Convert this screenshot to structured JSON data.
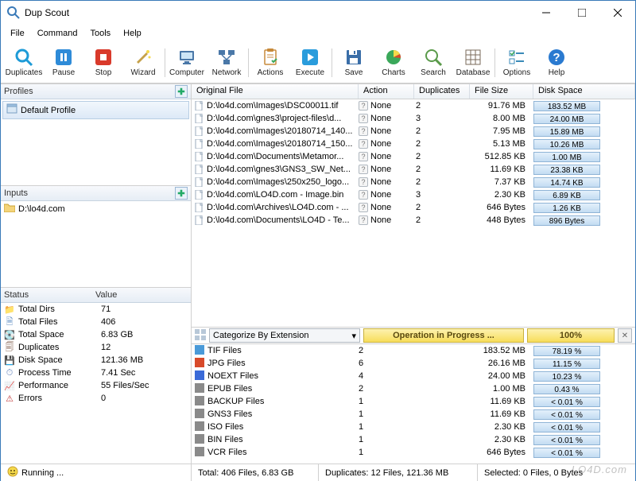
{
  "app": {
    "title": "Dup Scout"
  },
  "menu": [
    "File",
    "Command",
    "Tools",
    "Help"
  ],
  "toolbar": [
    {
      "id": "duplicates",
      "label": "Duplicates",
      "icon": "#1e9bd7",
      "glyph": "⟳",
      "shape": "magnify"
    },
    {
      "id": "pause",
      "label": "Pause",
      "icon": "#2e8bd8",
      "glyph": "⏸",
      "shape": "pause"
    },
    {
      "id": "stop",
      "label": "Stop",
      "icon": "#d93a2b",
      "glyph": "⏹",
      "shape": "stop"
    },
    {
      "id": "wizard",
      "label": "Wizard",
      "icon": "#c6a14a",
      "glyph": "🪄",
      "shape": "wizard"
    },
    {
      "id": "sep"
    },
    {
      "id": "computer",
      "label": "Computer",
      "icon": "#4a78a8",
      "glyph": "🖥",
      "shape": "monitor"
    },
    {
      "id": "network",
      "label": "Network",
      "icon": "#4a78a8",
      "glyph": "🖧",
      "shape": "network"
    },
    {
      "id": "sep"
    },
    {
      "id": "actions",
      "label": "Actions",
      "icon": "#c78a3a",
      "glyph": "📋",
      "shape": "clipboard"
    },
    {
      "id": "execute",
      "label": "Execute",
      "icon": "#2a9cdc",
      "glyph": "▶",
      "shape": "play"
    },
    {
      "id": "sep"
    },
    {
      "id": "save",
      "label": "Save",
      "icon": "#3a6ea8",
      "glyph": "💾",
      "shape": "floppy"
    },
    {
      "id": "charts",
      "label": "Charts",
      "icon": "#3aa85a",
      "glyph": "📊",
      "shape": "pie"
    },
    {
      "id": "search",
      "label": "Search",
      "icon": "#5a9a4a",
      "glyph": "🔍",
      "shape": "magnify2"
    },
    {
      "id": "database",
      "label": "Database",
      "icon": "#7a6a5a",
      "glyph": "🗄",
      "shape": "grid"
    },
    {
      "id": "sep"
    },
    {
      "id": "options",
      "label": "Options",
      "icon": "#3a8ab8",
      "glyph": "☑",
      "shape": "checklist"
    },
    {
      "id": "help",
      "label": "Help",
      "icon": "#2a7ad0",
      "glyph": "?",
      "shape": "help"
    }
  ],
  "profiles": {
    "title": "Profiles",
    "items": [
      "Default Profile"
    ]
  },
  "inputs": {
    "title": "Inputs",
    "items": [
      "D:\\lo4d.com"
    ]
  },
  "status_cols": {
    "k": "Status",
    "v": "Value"
  },
  "status_rows": [
    {
      "k": "Total Dirs",
      "v": "71",
      "glyph": "📁",
      "color": "#e6b84a"
    },
    {
      "k": "Total Files",
      "v": "406",
      "glyph": "🗎",
      "color": "#5a8ac0"
    },
    {
      "k": "Total Space",
      "v": "6.83 GB",
      "glyph": "💽",
      "color": "#6a9a7a"
    },
    {
      "k": "Duplicates",
      "v": "12",
      "glyph": "🗐",
      "color": "#8a6a5a"
    },
    {
      "k": "Disk Space",
      "v": "121.36 MB",
      "glyph": "💾",
      "color": "#3a6ea8"
    },
    {
      "k": "Process Time",
      "v": "7.41 Sec",
      "glyph": "⏱",
      "color": "#6a8ac0"
    },
    {
      "k": "Performance",
      "v": "55 Files/Sec",
      "glyph": "📈",
      "color": "#c06a3a"
    },
    {
      "k": "Errors",
      "v": "0",
      "glyph": "⚠",
      "color": "#c03a3a"
    }
  ],
  "main_cols": {
    "file": "Original File",
    "action": "Action",
    "dup": "Duplicates",
    "size": "File Size",
    "space": "Disk Space"
  },
  "rows": [
    {
      "file": "D:\\lo4d.com\\Images\\DSC00011.tif",
      "action": "None",
      "dup": "2",
      "size": "91.76 MB",
      "space": "183.52 MB"
    },
    {
      "file": "D:\\lo4d.com\\gnes3\\project-files\\d...",
      "action": "None",
      "dup": "3",
      "size": "8.00 MB",
      "space": "24.00 MB"
    },
    {
      "file": "D:\\lo4d.com\\Images\\20180714_140...",
      "action": "None",
      "dup": "2",
      "size": "7.95 MB",
      "space": "15.89 MB"
    },
    {
      "file": "D:\\lo4d.com\\Images\\20180714_150...",
      "action": "None",
      "dup": "2",
      "size": "5.13 MB",
      "space": "10.26 MB"
    },
    {
      "file": "D:\\lo4d.com\\Documents\\Metamor...",
      "action": "None",
      "dup": "2",
      "size": "512.85 KB",
      "space": "1.00 MB"
    },
    {
      "file": "D:\\lo4d.com\\gnes3\\GNS3_SW_Net...",
      "action": "None",
      "dup": "2",
      "size": "11.69 KB",
      "space": "23.38 KB"
    },
    {
      "file": "D:\\lo4d.com\\Images\\250x250_logo...",
      "action": "None",
      "dup": "2",
      "size": "7.37 KB",
      "space": "14.74 KB"
    },
    {
      "file": "D:\\lo4d.com\\LO4D.com - Image.bin",
      "action": "None",
      "dup": "3",
      "size": "2.30 KB",
      "space": "6.89 KB"
    },
    {
      "file": "D:\\lo4d.com\\Archives\\LO4D.com - ...",
      "action": "None",
      "dup": "2",
      "size": "646 Bytes",
      "space": "1.26 KB"
    },
    {
      "file": "D:\\lo4d.com\\Documents\\LO4D - Te...",
      "action": "None",
      "dup": "2",
      "size": "448 Bytes",
      "space": "896 Bytes"
    }
  ],
  "category": {
    "label": "Categorize By Extension",
    "progress": "Operation in Progress ...",
    "percent": "100%"
  },
  "cat_rows": [
    {
      "name": "TIF Files",
      "cnt": "2",
      "sz": "183.52 MB",
      "pct": "78.19 %",
      "color": "#4a9ad8"
    },
    {
      "name": "JPG Files",
      "cnt": "6",
      "sz": "26.16 MB",
      "pct": "11.15 %",
      "color": "#d84a2a"
    },
    {
      "name": "NOEXT Files",
      "cnt": "4",
      "sz": "24.00 MB",
      "pct": "10.23 %",
      "color": "#3a6ad8"
    },
    {
      "name": "EPUB Files",
      "cnt": "2",
      "sz": "1.00 MB",
      "pct": "0.43 %",
      "color": "#8a8a8a"
    },
    {
      "name": "BACKUP Files",
      "cnt": "1",
      "sz": "11.69 KB",
      "pct": "< 0.01 %",
      "color": "#8a8a8a"
    },
    {
      "name": "GNS3 Files",
      "cnt": "1",
      "sz": "11.69 KB",
      "pct": "< 0.01 %",
      "color": "#8a8a8a"
    },
    {
      "name": "ISO Files",
      "cnt": "1",
      "sz": "2.30 KB",
      "pct": "< 0.01 %",
      "color": "#8a8a8a"
    },
    {
      "name": "BIN Files",
      "cnt": "1",
      "sz": "2.30 KB",
      "pct": "< 0.01 %",
      "color": "#8a8a8a"
    },
    {
      "name": "VCR Files",
      "cnt": "1",
      "sz": "646 Bytes",
      "pct": "< 0.01 %",
      "color": "#8a8a8a"
    }
  ],
  "statusbar": {
    "running": "Running ...",
    "total": "Total: 406 Files, 6.83 GB",
    "dup": "Duplicates: 12 Files, 121.36 MB",
    "sel": "Selected: 0 Files, 0 Bytes"
  },
  "watermark": "LO4D.com"
}
